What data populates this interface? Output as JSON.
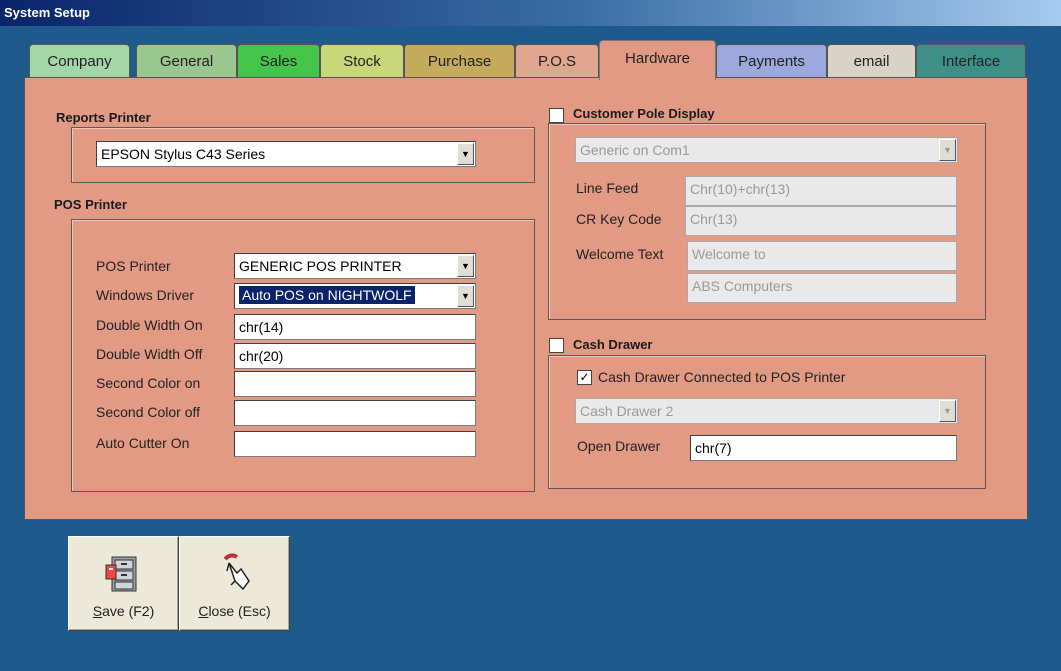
{
  "window": {
    "title": "System Setup"
  },
  "colors": {
    "panel": "#e29a85"
  },
  "tabs": [
    {
      "label": "Company",
      "color": "#a5d6a8"
    },
    {
      "label": "General",
      "color": "#9bc78f"
    },
    {
      "label": "Sales",
      "color": "#44c44a"
    },
    {
      "label": "Stock",
      "color": "#c8d77a"
    },
    {
      "label": "Purchase",
      "color": "#c4ac5c"
    },
    {
      "label": "P.O.S",
      "color": "#e0a690"
    },
    {
      "label": "Hardware",
      "color": "#e29a85",
      "active": true
    },
    {
      "label": "Payments",
      "color": "#9da8dc"
    },
    {
      "label": "email",
      "color": "#d9d3c7"
    },
    {
      "label": "Interface",
      "color": "#3d8f87"
    }
  ],
  "reports_printer": {
    "title": "Reports Printer",
    "value": "EPSON Stylus C43 Series"
  },
  "pos_printer": {
    "title": "POS Printer",
    "fields": {
      "printer": {
        "label": "POS Printer",
        "value": "GENERIC POS PRINTER"
      },
      "driver": {
        "label": "Windows Driver",
        "value": "Auto POS on NIGHTWOLF"
      },
      "dw_on": {
        "label": "Double Width On",
        "value": "chr(14)"
      },
      "dw_off": {
        "label": "Double Width Off",
        "value": "chr(20)"
      },
      "sc_on": {
        "label": "Second Color on",
        "value": ""
      },
      "sc_off": {
        "label": "Second Color off",
        "value": ""
      },
      "cutter": {
        "label": "Auto Cutter On",
        "value": ""
      }
    }
  },
  "pole_display": {
    "title": "Customer Pole Display",
    "checked": false,
    "device": "Generic on Com1",
    "line_feed": {
      "label": "Line Feed",
      "value": "Chr(10)+chr(13)"
    },
    "cr_key": {
      "label": "CR Key Code",
      "value": "Chr(13)"
    },
    "welcome": {
      "label": "Welcome Text",
      "line1": "Welcome to",
      "line2": "ABS Computers"
    }
  },
  "cash_drawer": {
    "title": "Cash Drawer",
    "checked": false,
    "connected_label": "Cash Drawer Connected to POS Printer",
    "connected": true,
    "device": "Cash Drawer 2",
    "open": {
      "label": "Open Drawer",
      "value": "chr(7)"
    }
  },
  "buttons": {
    "save": {
      "label": "Save (F2)",
      "hotkey_char": "S",
      "rest": "ave (F2)"
    },
    "close": {
      "label": "Close (Esc)",
      "hotkey_char": "C",
      "rest": "lose (Esc)"
    }
  }
}
